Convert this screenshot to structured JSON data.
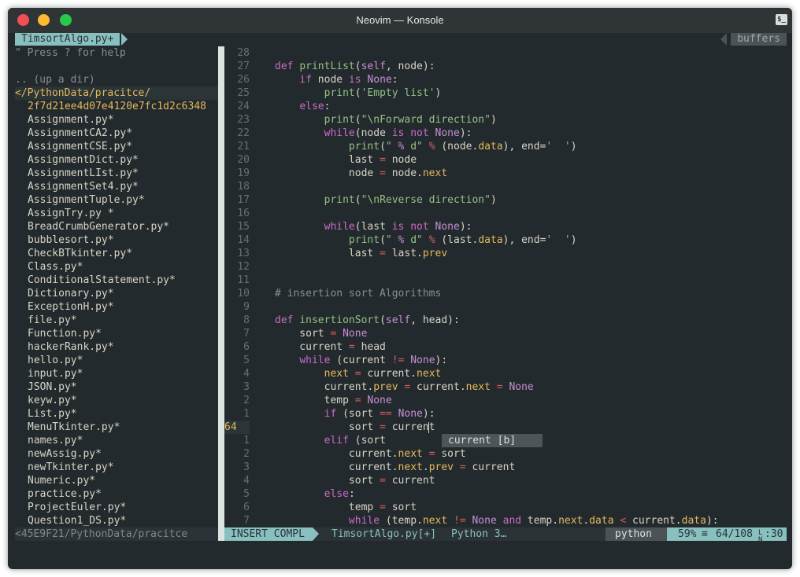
{
  "window": {
    "title": "Neovim — Konsole",
    "traffic_lights": {
      "close": "#f24e56",
      "minimize": "#fdbb2f",
      "maximize": "#2ac84a"
    },
    "terminal_icon": "terminal-icon",
    "terminal_icon_text": "$_"
  },
  "bufferline": {
    "active_tab": "TimsortAlgo.py+",
    "buffers_label": "buffers"
  },
  "explorer": {
    "help": "\" Press ? for help",
    "up_dir": ".. (up a dir)",
    "current_dir": "</PythonData/pracitce/",
    "items": [
      "2f7d21ee4d07e4120e7fc1d2c6348",
      "Assignment.py*",
      "AssignmentCA2.py*",
      "AssignmentCSE.py*",
      "AssignmentDict.py*",
      "AssignmentLIst.py*",
      "AssignmentSet4.py*",
      "AssignmentTuple.py*",
      "AssignTry.py *",
      "BreadCrumbGenerator.py*",
      "bubblesort.py*",
      "CheckBTkinter.py*",
      "Class.py*",
      "ConditionalStatement.py*",
      "Dictionary.py*",
      "ExceptionH.py*",
      "file.py*",
      "Function.py*",
      "hackerRank.py*",
      "hello.py*",
      "input.py*",
      "JSON.py*",
      "keyw.py*",
      "List.py*",
      "MenuTkinter.py*",
      "names.py*",
      "newAssig.py*",
      "newTkinter.py*",
      "Numeric.py*",
      "practice.py*",
      "ProjectEuler.py*",
      "Question1_DS.py*"
    ]
  },
  "editor": {
    "line_numbers": [
      "28",
      "27",
      "26",
      "25",
      "24",
      "23",
      "22",
      "21",
      "20",
      "19",
      "18",
      "17",
      "16",
      "15",
      "14",
      "13",
      "12",
      "11",
      "10",
      "9",
      "8",
      "7",
      "6",
      "5",
      "4",
      "3",
      "2",
      "1",
      "64",
      "1",
      "2",
      "3",
      "4",
      "5",
      "6",
      "7"
    ],
    "current_line_index": 28,
    "completion_popup": "current [b]"
  },
  "statusline": {
    "left_path": "<45E9F21/PythonData/pracitce",
    "mode": "INSERT COMPL",
    "file": "TimsortAlgo.py[+]",
    "filetype_info": "Python 3…",
    "filetype": "python",
    "percent": "59%",
    "position": "64/108",
    "column": ":30"
  }
}
